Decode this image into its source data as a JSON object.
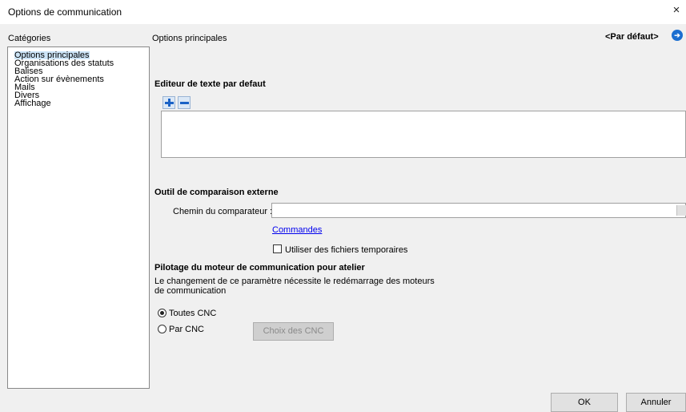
{
  "window": {
    "title": "Options de communication",
    "close_glyph": "×"
  },
  "header": {
    "categories_label": "Catégories",
    "section_label": "Options principales",
    "default_label": "<Par défaut>",
    "nav_icon": "arrow-circle-icon"
  },
  "categories": [
    "Options principales",
    "Organisations des statuts",
    "Balises",
    "Action sur évènements",
    "Mails",
    "Divers",
    "Affichage"
  ],
  "editor": {
    "title": "Editeur de texte par defaut",
    "add_icon": "+",
    "remove_icon": "−"
  },
  "compare": {
    "title": "Outil de comparaison externe",
    "path_label": "Chemin du comparateur :",
    "path_value": "",
    "commands_link": "Commandes",
    "temp_files_label": "Utiliser des fichiers temporaires",
    "temp_files_checked": false
  },
  "pilot": {
    "title": "Pilotage du moteur de communication pour atelier",
    "note_line1": "Le changement de ce paramètre nécessite le redémarrage des moteurs",
    "note_line2": "de communication",
    "option_all": "Toutes CNC",
    "option_per": "Par CNC",
    "selected": "Toutes CNC",
    "choose_button": "Choix des CNC"
  },
  "footer": {
    "ok": "OK",
    "cancel": "Annuler"
  }
}
